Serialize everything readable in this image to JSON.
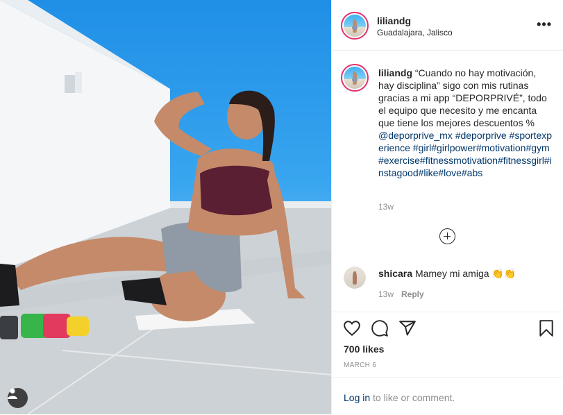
{
  "post": {
    "author": "liliandg",
    "location": "Guadalajara, Jalisco",
    "more_label": "•••"
  },
  "caption": {
    "author": "liliandg",
    "text": "“Cuando no hay motivación, hay disciplina” sigo con mis rutinas gracias a mi app “DEPORPRIVÉ”, todo el equipo que necesito y me encanta que tiene los mejores descuentos %",
    "mention": "@deporprive_mx",
    "hashtags": "#deporprive #sportexperience #girl#girlpower#motivation#gym#exercise#fitnessmotivation#fitnessgirl#instagood#like#love#abs",
    "time": "13w"
  },
  "comment": {
    "author": "shicara",
    "text": "Mamey mi amiga 👏👏",
    "time": "13w",
    "reply_label": "Reply"
  },
  "engagement": {
    "likes": "700 likes",
    "date": "MARCH 6"
  },
  "login": {
    "link": "Log in",
    "rest": " to like or comment."
  },
  "icons": {
    "like": "heart-icon",
    "comment": "comment-icon",
    "share": "share-icon",
    "save": "bookmark-icon",
    "tag": "user-tag-icon",
    "more": "more-options-icon",
    "load_more": "plus-circle-icon"
  }
}
